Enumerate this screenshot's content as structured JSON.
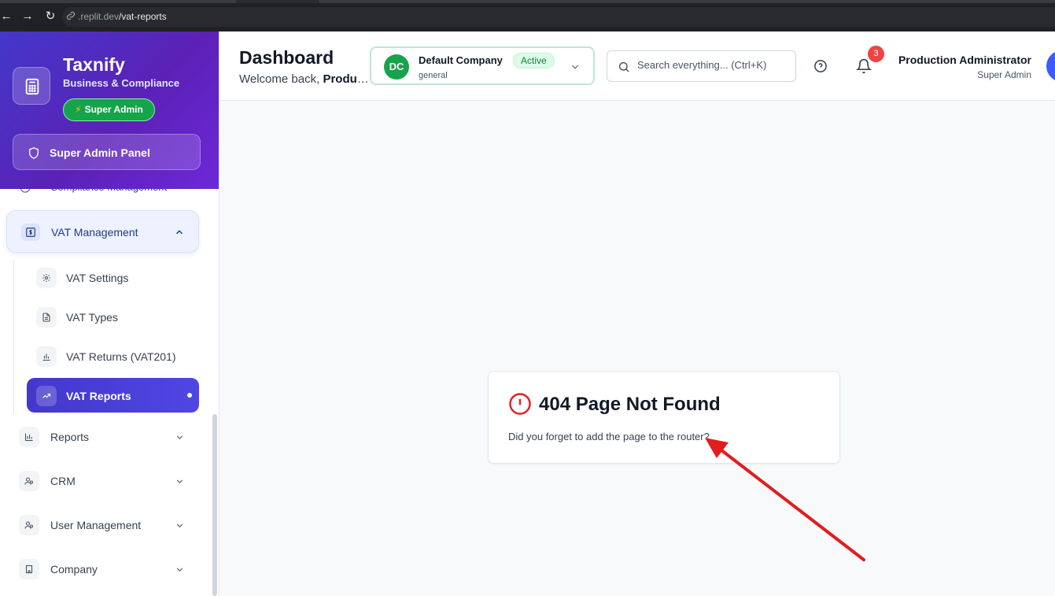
{
  "browser": {
    "url_dim": ".replit.dev",
    "url_path": "/vat-reports"
  },
  "sidebar": {
    "brand_name": "Taxnify",
    "brand_subtitle": "Business & Compliance",
    "role_badge": "Super Admin",
    "admin_panel_label": "Super Admin Panel",
    "partial_item_label": "Compliance Management",
    "vat_group_label": "VAT Management",
    "vat_items": [
      {
        "label": "VAT Settings",
        "icon": "gear-icon"
      },
      {
        "label": "VAT Types",
        "icon": "document-icon"
      },
      {
        "label": "VAT Returns (VAT201)",
        "icon": "bar-chart-icon"
      },
      {
        "label": "VAT Reports",
        "icon": "trending-up-icon",
        "active": true
      }
    ],
    "nav_items": [
      {
        "label": "Reports",
        "icon": "bar-chart-icon"
      },
      {
        "label": "CRM",
        "icon": "users-icon"
      },
      {
        "label": "User Management",
        "icon": "user-cog-icon"
      },
      {
        "label": "Company",
        "icon": "building-icon"
      }
    ]
  },
  "header": {
    "title": "Dashboard",
    "welcome_prefix": "Welcome back, ",
    "welcome_name": "Production Administrator",
    "company": {
      "initials": "DC",
      "name": "Default Company",
      "status": "Active",
      "subtitle": "general"
    },
    "search_placeholder": "Search everything... (Ctrl+K)",
    "notification_count": "3",
    "user_name": "Production Administrator",
    "user_role": "Super Admin"
  },
  "error": {
    "title": "404 Page Not Found",
    "message": "Did you forget to add the page to the router?"
  },
  "colors": {
    "brand_gradient_start": "#4338ca",
    "brand_gradient_end": "#6d28d9",
    "active_nav": "#4f46e5",
    "success": "#16a34a",
    "error": "#dc2626",
    "annotation_arrow": "#e11d1d"
  }
}
